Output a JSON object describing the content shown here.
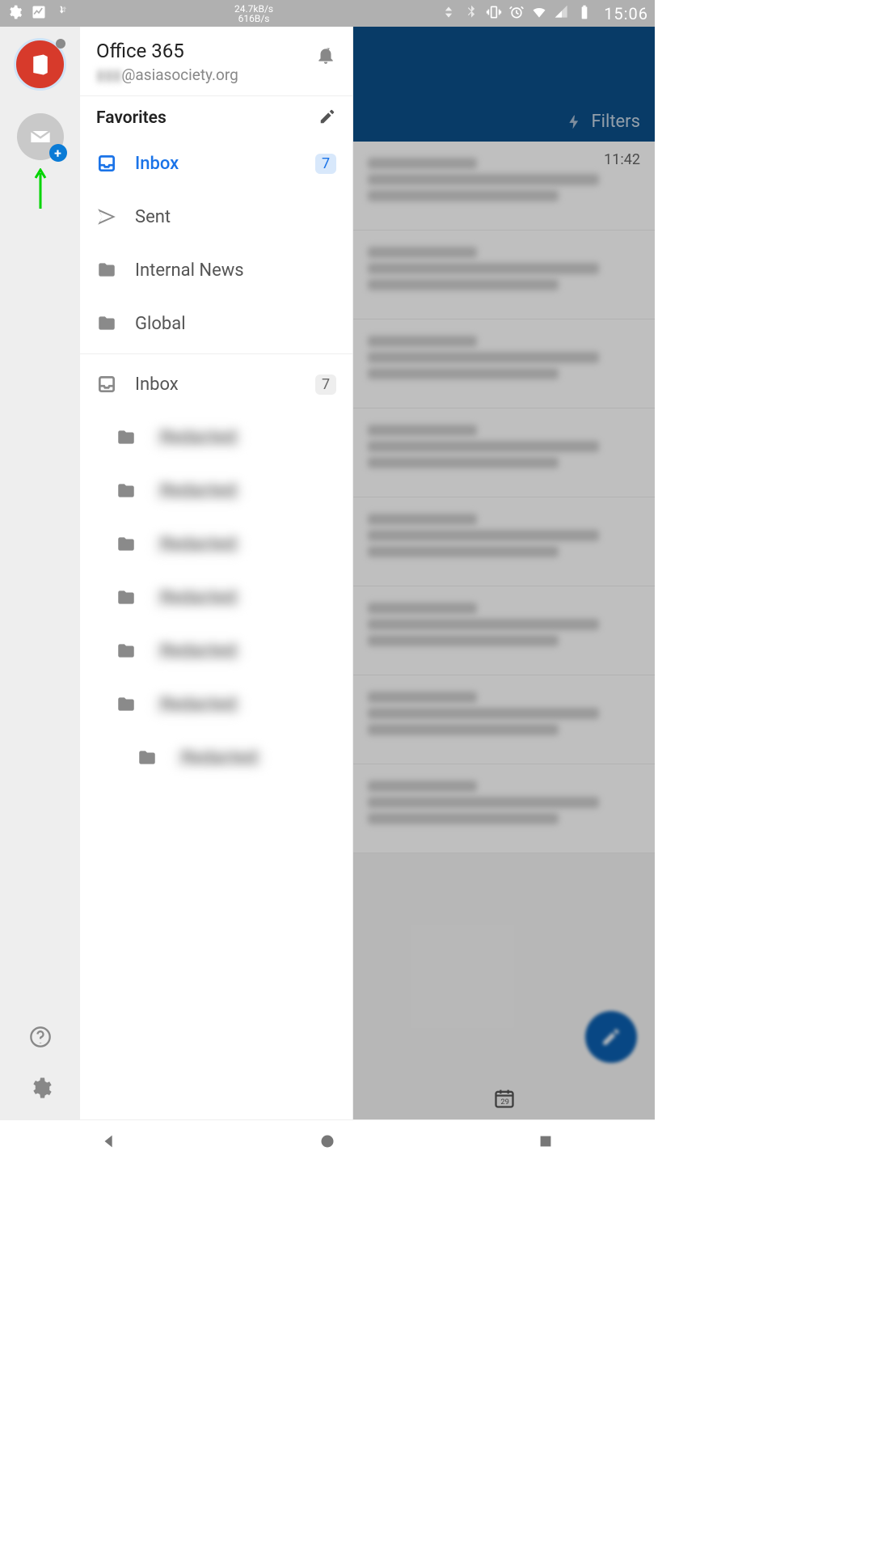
{
  "statusbar": {
    "net_up": "24.7kB/s",
    "net_down": "616B/s",
    "time": "15:06"
  },
  "account": {
    "service": "Office 365",
    "email_hidden_prefix": "▮▮▮",
    "email_suffix": "@asiasociety.org"
  },
  "favorites": {
    "title": "Favorites",
    "items": [
      {
        "label": "Inbox",
        "badge": "7",
        "icon": "inbox",
        "active": true
      },
      {
        "label": "Sent",
        "icon": "sent"
      },
      {
        "label": "Internal News",
        "icon": "folder"
      },
      {
        "label": "Global",
        "icon": "folder"
      }
    ]
  },
  "folders": {
    "root": {
      "label": "Inbox",
      "badge": "7"
    },
    "subfolders": [
      {
        "label": "Redacted"
      },
      {
        "label": "Redacted"
      },
      {
        "label": "Redacted"
      },
      {
        "label": "Redacted"
      },
      {
        "label": "Redacted"
      },
      {
        "label": "Redacted"
      }
    ],
    "nested": {
      "label": "Redacted"
    }
  },
  "backdrop": {
    "filters_label": "Filters",
    "first_time": "11:42",
    "calendar_day": "29"
  }
}
